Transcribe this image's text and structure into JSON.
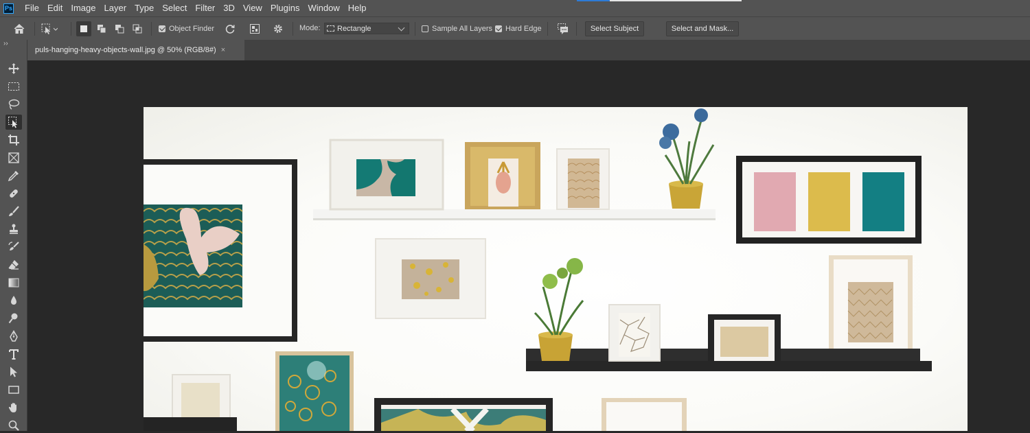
{
  "app": {
    "logo_text": "Ps"
  },
  "menu": [
    "File",
    "Edit",
    "Image",
    "Layer",
    "Type",
    "Select",
    "Filter",
    "3D",
    "View",
    "Plugins",
    "Window",
    "Help"
  ],
  "options": {
    "object_finder_label": "Object Finder",
    "object_finder_checked": true,
    "mode_label": "Mode:",
    "mode_value": "Rectangle",
    "sample_all_layers_label": "Sample All Layers",
    "sample_all_layers_checked": false,
    "hard_edge_label": "Hard Edge",
    "hard_edge_checked": true,
    "select_subject_label": "Select Subject",
    "select_and_mask_label": "Select and Mask..."
  },
  "document": {
    "tab_title": "puls-hanging-heavy-objects-wall.jpg @ 50% (RGB/8#)",
    "close_glyph": "×"
  },
  "toolbar": {
    "handle_glyph": "››",
    "tools": [
      "move-tool",
      "rectangular-marquee-tool",
      "lasso-tool",
      "object-selection-tool",
      "crop-tool",
      "frame-tool",
      "eyedropper-tool",
      "spot-healing-brush-tool",
      "brush-tool",
      "clone-stamp-tool",
      "history-brush-tool",
      "eraser-tool",
      "gradient-tool",
      "blur-tool",
      "dodge-tool",
      "pen-tool",
      "type-tool",
      "path-selection-tool",
      "rectangle-tool",
      "hand-tool",
      "zoom-tool"
    ],
    "active_tool": "object-selection-tool"
  },
  "colors": {
    "panel": "#535353",
    "canvas_bg": "#282828",
    "accent": "#31a8ff"
  }
}
